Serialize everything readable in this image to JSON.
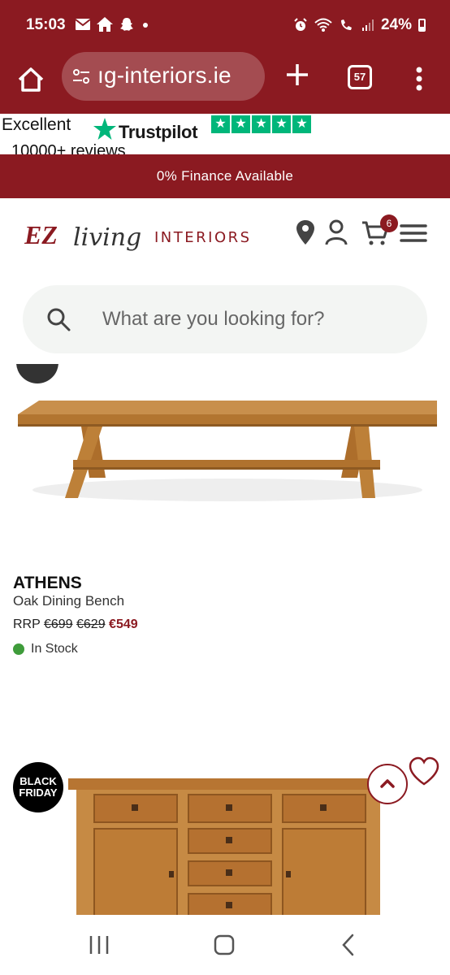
{
  "status_bar": {
    "time": "15:03",
    "battery": "24%",
    "icons": [
      "mail-icon",
      "home-icon",
      "snapchat-icon",
      "dot-icon",
      "alarm-icon",
      "wifi-icon",
      "wifi-call-icon",
      "signal-icon",
      "battery-icon"
    ]
  },
  "browser": {
    "url": "ıg-interiors.ie",
    "tab_count": "57"
  },
  "trustpilot": {
    "rating_word": "Excellent",
    "brand": "Trustpilot",
    "reviews": "10000+ reviews",
    "star_color": "#00b67a"
  },
  "promo": {
    "text": "0% Finance Available"
  },
  "header": {
    "logo_ez": "EZ",
    "logo_living": "living",
    "logo_interiors": "INTERIORS",
    "cart_count": "6",
    "accent": "#8b1a21"
  },
  "search": {
    "placeholder": "What are you looking for?"
  },
  "products": [
    {
      "brand": "ATHENS",
      "name": "Oak Dining Bench",
      "rrp_label": "RRP",
      "rrp": "€699",
      "was": "€629",
      "price": "€549",
      "stock": "In Stock"
    },
    {
      "badge_line1": "BLACK",
      "badge_line2": "FRIDAY"
    }
  ]
}
